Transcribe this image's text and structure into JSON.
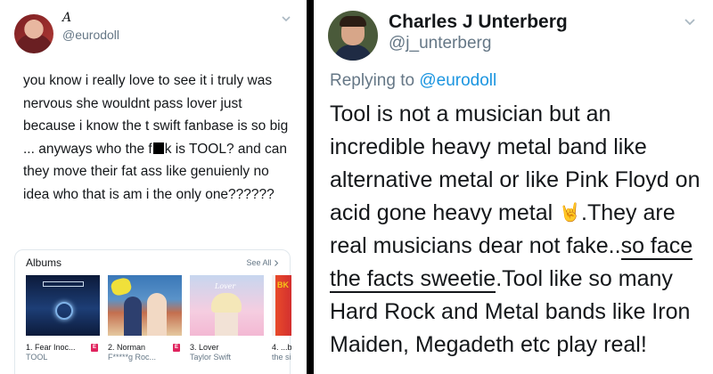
{
  "left_tweet": {
    "display_name": "A",
    "handle": "@eurodoll",
    "text_before_censor": "you know i really love to see it i truly was nervous she wouldnt pass lover just because i know the t swift fanbase is so big ... anyways who the f",
    "text_after_censor": "k is TOOL? and can they move their fat ass like genuienly no idea who that is am i the only one??????",
    "albums_card": {
      "title": "Albums",
      "see_all": "See All",
      "items": [
        {
          "title": "1. Fear Inoc...",
          "artist": "TOOL",
          "explicit": "E"
        },
        {
          "title": "2. Norman",
          "artist": "F*****g Roc...",
          "explicit": "E"
        },
        {
          "title": "3. Lover",
          "artist": "Taylor Swift",
          "explicit": ""
        },
        {
          "title": "4. ...b",
          "artist": "the si",
          "explicit": ""
        }
      ],
      "cover_texts": {
        "lover": "Lover",
        "bk": "BK"
      }
    }
  },
  "right_tweet": {
    "display_name": "Charles J Unterberg",
    "handle": "@j_unterberg",
    "replying_prefix": "Replying to ",
    "replying_to": "@eurodoll",
    "text_part1": "Tool is not a musician but an incredible heavy metal band like alternative metal or like Pink Floyd on acid gone heavy metal ",
    "emoji": "🤘",
    "text_part2": ".They are real musicians dear not fake..",
    "text_underlined": "so face the facts sweetie",
    "text_part3": ".Tool like so many Hard Rock and Metal bands like Iron Maiden, Megadeth etc play real!"
  },
  "colors": {
    "text_primary": "#14171a",
    "text_secondary": "#657786",
    "link": "#1b95e0",
    "explicit_badge": "#e0245e",
    "separator": "#000000"
  },
  "icons": [
    "chevron-down-icon",
    "chevron-right-icon"
  ]
}
